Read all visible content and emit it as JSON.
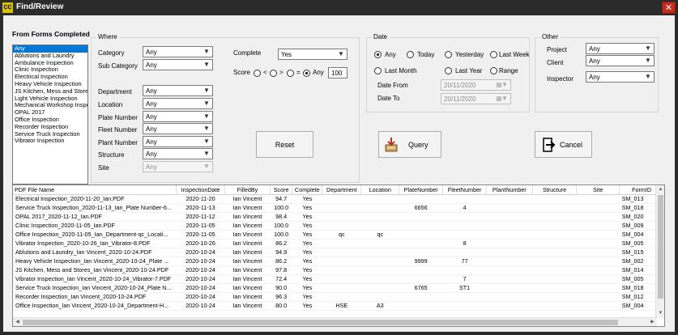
{
  "window": {
    "app_icon": "CC",
    "title": "Find/Review",
    "close_glyph": "✕"
  },
  "forms": {
    "title": "From Forms Completed",
    "items": [
      "Any",
      "Ablutions and Laundry",
      "Ambulance Inspection",
      "Clinic Inspection",
      "Electrical Inspection",
      "Heavy Vehicle Inspection",
      "JS Kitchen, Mess and Stores",
      "Light Vehicle Inspection",
      "Mechanical Workshop Inspe",
      "OPAL 2017",
      "Office Inspection",
      "Recorder Inspection",
      "Service Truck Inspection",
      "Vibrator Inspection"
    ],
    "selected_index": 0
  },
  "where": {
    "title": "Where",
    "category": {
      "label": "Category",
      "value": "Any"
    },
    "sub_category": {
      "label": "Sub Category",
      "value": "Any"
    },
    "department": {
      "label": "Department",
      "value": "Any"
    },
    "location": {
      "label": "Location",
      "value": "Any"
    },
    "plate_number": {
      "label": "Plate Number",
      "value": "Any"
    },
    "fleet_number": {
      "label": "Fleet Number",
      "value": "Any"
    },
    "plant_number": {
      "label": "Plant Number",
      "value": "Any"
    },
    "structure": {
      "label": "Structure",
      "value": "Any"
    },
    "site": {
      "label": "Site",
      "value": "Any"
    },
    "complete": {
      "label": "Complete",
      "value": "Yes"
    },
    "score": {
      "label": "Score",
      "lt": "<",
      "gt": ">",
      "eq": "=",
      "any": "Any",
      "selected": "any",
      "value": "100"
    }
  },
  "date": {
    "title": "Date",
    "options": {
      "any": "Any",
      "today": "Today",
      "yesterday": "Yesterday",
      "last_week": "Last Week",
      "last_month": "Last Month",
      "last_year": "Last Year",
      "range": "Range"
    },
    "selected": "any",
    "from": {
      "label": "Date From",
      "value": "20/11/2020"
    },
    "to": {
      "label": "Date To",
      "value": "20/11/2020"
    }
  },
  "other": {
    "title": "Other",
    "project": {
      "label": "Project",
      "value": "Any"
    },
    "client": {
      "label": "Client",
      "value": "Any"
    },
    "inspector": {
      "label": "Inspector",
      "value": "Any"
    }
  },
  "buttons": {
    "reset": "Reset",
    "query": "Query",
    "cancel": "Cancel"
  },
  "table": {
    "columns": [
      "PDF File Name",
      "InspectionDate",
      "FilledBy",
      "Score",
      "Complete",
      "Department",
      "Location",
      "PlateNumber",
      "FleetNumber",
      "PlantNumber",
      "Structure",
      "Site",
      "FormID"
    ],
    "rows": [
      [
        "Electrical Inspection_2020-11-20_Ian.PDF",
        "2020-11-20",
        "Ian Vincent",
        "94.7",
        "Yes",
        "",
        "",
        "",
        "",
        "",
        "",
        "",
        "SM_013"
      ],
      [
        "Service Truck Inspection_2020-11-13_Ian_Plate Number-6...",
        "2020-11-13",
        "Ian Vincent",
        "100.0",
        "Yes",
        "",
        "",
        "6656",
        "4",
        "",
        "",
        "",
        "SM_018"
      ],
      [
        "OPAL 2017_2020-11-12_Ian.PDF",
        "2020-11-12",
        "Ian Vincent",
        "98.4",
        "Yes",
        "",
        "",
        "",
        "",
        "",
        "",
        "",
        "SM_020"
      ],
      [
        "Clinic Inspection_2020-11-05_Ian.PDF",
        "2020-11-05",
        "Ian Vincent",
        "100.0",
        "Yes",
        "",
        "",
        "",
        "",
        "",
        "",
        "",
        "SM_009"
      ],
      [
        "Office Inspection_2020-11-05_Ian_Department-qc_Locati...",
        "2020-11-05",
        "Ian Vincent",
        "100.0",
        "Yes",
        "qc",
        "qc",
        "",
        "",
        "",
        "",
        "",
        "SM_004"
      ],
      [
        "Vibrator Inspection_2020-10-26_Ian_Vibrator-8.PDF",
        "2020-10-26",
        "Ian Vincent",
        "86.2",
        "Yes",
        "",
        "",
        "",
        "8",
        "",
        "",
        "",
        "SM_005"
      ],
      [
        "Ablutions and Laundry_Ian Vincent_2020-10-24.PDF",
        "2020-10-24",
        "Ian Vincent",
        "94.9",
        "Yes",
        "",
        "",
        "",
        "",
        "",
        "",
        "",
        "SM_015"
      ],
      [
        "Heavy Vehicle Inspection_Ian Vincent_2020-10-24_Plate ...",
        "2020-10-24",
        "Ian Vincent",
        "86.2",
        "Yes",
        "",
        "",
        "9999",
        "77",
        "",
        "",
        "",
        "SM_002"
      ],
      [
        "JS Kitchen, Mess and Stores_Ian Vincent_2020-10-24.PDF",
        "2020-10-24",
        "Ian Vincent",
        "97.8",
        "Yes",
        "",
        "",
        "",
        "",
        "",
        "",
        "",
        "SM_014"
      ],
      [
        "Vibrator Inspection_Ian Vincent_2020-10-24_Vibrator-7.PDF",
        "2020-10-24",
        "Ian Vincent",
        "72.4",
        "Yes",
        "",
        "",
        "",
        "7",
        "",
        "",
        "",
        "SM_005"
      ],
      [
        "Service Truck Inspection_Ian Vincent_2020-10-24_Plate N...",
        "2020-10-24",
        "Ian Vincent",
        "90.0",
        "Yes",
        "",
        "",
        "6765",
        "ST1",
        "",
        "",
        "",
        "SM_018"
      ],
      [
        "Recorder Inspection_Ian Vincent_2020-10-24.PDF",
        "2020-10-24",
        "Ian Vincent",
        "96.3",
        "Yes",
        "",
        "",
        "",
        "",
        "",
        "",
        "",
        "SM_012"
      ],
      [
        "Office Inspection_Ian Vincent_2020-10-24_Department-H...",
        "2020-10-24",
        "Ian Vincent",
        "80.0",
        "Yes",
        "HSE",
        "A3",
        "",
        "",
        "",
        "",
        "",
        "SM_004"
      ]
    ]
  }
}
